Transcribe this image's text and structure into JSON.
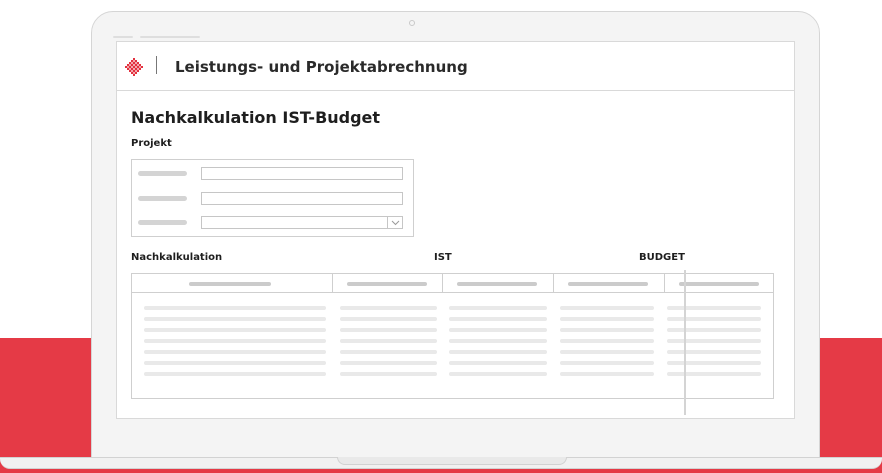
{
  "app": {
    "title": "Leistungs- und Projektabrechnung"
  },
  "page": {
    "title": "Nachkalkulation IST-Budget"
  },
  "project_section": {
    "label": "Projekt"
  },
  "table_section": {
    "labels": [
      "Nachkalkulation",
      "IST",
      "BUDGET"
    ]
  },
  "colors": {
    "brand_red": "#e53a46",
    "logo_red": "#e3313f",
    "logo_light": "#f2a8ad"
  },
  "icons": {
    "logo": "diamond-logo-icon",
    "select": "chevron-down-icon"
  }
}
